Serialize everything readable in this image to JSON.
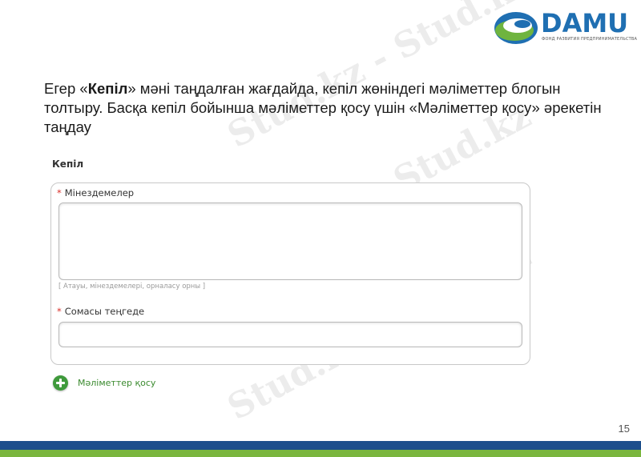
{
  "logo": {
    "name": "DAMU",
    "subtitle": "ФОНД РАЗВИТИЯ ПРЕДПРИНИМАТЕЛЬСТВА",
    "colors": {
      "blue": "#1f6fb2",
      "green": "#6fb43f"
    }
  },
  "watermark": {
    "text": "Stud.kz - Stud.kz"
  },
  "heading": {
    "part1": "Егер «",
    "bold": "Кепіл",
    "part2": "» мәні таңдалған жағдайда, кепіл жөніндегі мәліметтер блогын толтыру. Басқа кепіл бойынша мәліметтер қосу үшін «Мәліметтер қосу» әрекетін таңдау"
  },
  "form": {
    "section_title": "Кепіл",
    "required_mark": "*",
    "characteristics": {
      "label": "Мінездемелер",
      "value": "",
      "hint": "[ Атауы, мінездемелері, орналасу орны ]"
    },
    "amount": {
      "label": "Сомасы теңгеде",
      "value": ""
    },
    "add_button": {
      "label": "Мәліметтер қосу",
      "icon": "plus-circle-icon"
    }
  },
  "page_number": "15",
  "colors": {
    "band_blue": "#1d4f8c",
    "band_green": "#7ab63e",
    "required": "#d9302a",
    "add_link": "#3a8a2e"
  }
}
